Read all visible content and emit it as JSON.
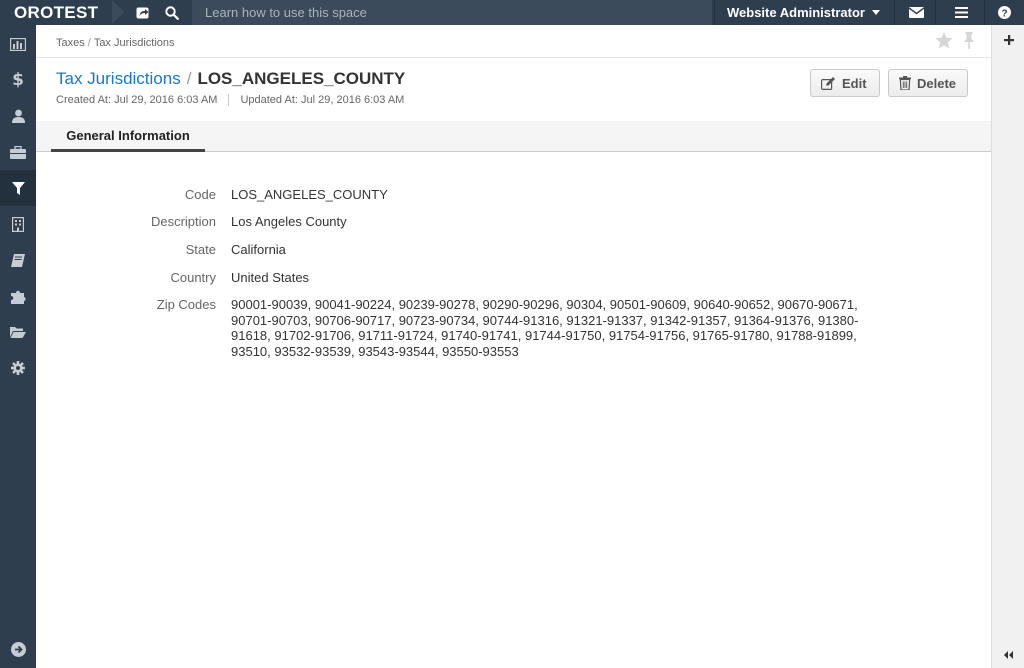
{
  "app": {
    "logo": "OROTEST"
  },
  "topbar": {
    "search_placeholder": "Learn how to use this space",
    "user_name": "Website Administrator"
  },
  "breadcrumb": {
    "items": [
      "Taxes",
      "Tax Jurisdictions"
    ]
  },
  "header": {
    "parent_link": "Tax Jurisdictions",
    "title": "LOS_ANGELES_COUNTY",
    "created": "Created At: Jul 29, 2016 6:03 AM",
    "updated": "Updated At: Jul 29, 2016 6:03 AM",
    "edit_label": "Edit",
    "delete_label": "Delete"
  },
  "tabs": [
    {
      "label": "General Information"
    }
  ],
  "details": {
    "code": {
      "label": "Code",
      "value": "LOS_ANGELES_COUNTY"
    },
    "description": {
      "label": "Description",
      "value": "Los Angeles County"
    },
    "state": {
      "label": "State",
      "value": "California"
    },
    "country": {
      "label": "Country",
      "value": "United States"
    },
    "zip_codes": {
      "label": "Zip Codes",
      "value": "90001-90039, 90041-90224, 90239-90278, 90290-90296, 90304, 90501-90609, 90640-90652, 90670-90671, 90701-90703, 90706-90717, 90723-90734, 90744-91316, 91321-91337, 91342-91357, 91364-91376, 91380-91618, 91702-91706, 91711-91724, 91740-91741, 91744-91750, 91754-91756, 91765-91780, 91788-91899, 93510, 93532-93539, 93543-93544, 93550-93553"
    }
  },
  "colors": {
    "nav_bg": "#2f3e4e",
    "link": "#1a78c2"
  },
  "icons": {
    "sidebar": [
      "dashboard-icon",
      "dollar-icon",
      "user-icon",
      "briefcase-icon",
      "filter-icon",
      "building-icon",
      "book-icon",
      "puzzle-icon",
      "folder-open-icon",
      "gear-icon"
    ]
  }
}
